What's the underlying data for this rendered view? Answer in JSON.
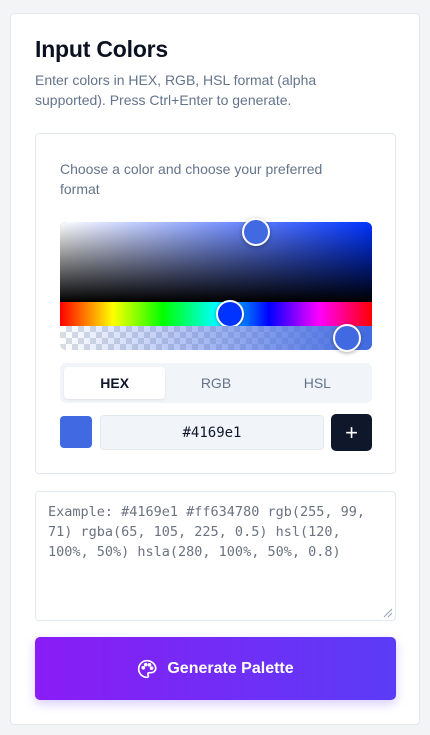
{
  "header": {
    "title": "Input Colors",
    "subtitle": "Enter colors in HEX, RGB, HSL format (alpha supported). Press Ctrl+Enter to generate."
  },
  "picker": {
    "description": "Choose a color and choose your preferred format",
    "selected_color": "#4169e1",
    "hue_color": "#0033ff",
    "formats": [
      "HEX",
      "RGB",
      "HSL"
    ],
    "active_format": "HEX",
    "hex_value": "#4169e1",
    "add_label": "+"
  },
  "input": {
    "placeholder": "Example: #4169e1 #ff634780 rgb(255, 99, 71) rgba(65, 105, 225, 0.5) hsl(120, 100%, 50%) hsla(280, 100%, 50%, 0.8)",
    "value": ""
  },
  "generate": {
    "label": "Generate Palette",
    "icon": "palette-icon"
  }
}
